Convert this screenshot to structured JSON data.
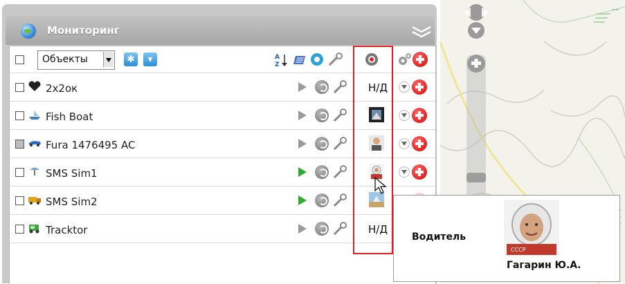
{
  "header": {
    "title": "Мониторинг"
  },
  "toolbar": {
    "select_value": "Объекты"
  },
  "objects": [
    {
      "name": "2x2ок",
      "icon": "heart-icon",
      "driver": "Н/Д"
    },
    {
      "name": "Fish Boat",
      "icon": "boat-icon",
      "driver": "photo"
    },
    {
      "name": "Fura 1476495 AC",
      "icon": "car-icon",
      "driver": "photo"
    },
    {
      "name": "SMS Sim1",
      "icon": "antenna-icon",
      "driver": "photo"
    },
    {
      "name": "SMS Sim2",
      "icon": "truck-icon",
      "driver": "photo"
    },
    {
      "name": "Tracktor",
      "icon": "tractor-icon",
      "driver": "Н/Д"
    }
  ],
  "tooltip": {
    "label": "Водитель",
    "driver_name": "Гагарин Ю.А."
  },
  "colors": {
    "highlight": "#e31b1b",
    "header": "#a7a7a7",
    "accent_blue": "#2d8fd4"
  }
}
